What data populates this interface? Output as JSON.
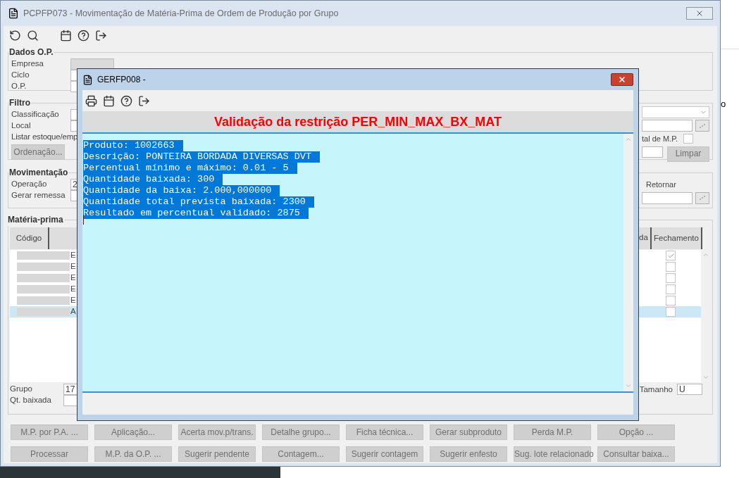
{
  "window": {
    "title": "PCPFP073 - Movimentação de Matéria-Prima de Ordem de Produção por Grupo"
  },
  "dados_op": {
    "title": "Dados O.P.",
    "fields": [
      {
        "label": "Empresa"
      },
      {
        "label": "Ciclo"
      },
      {
        "label": "O.P."
      }
    ]
  },
  "filtro": {
    "title": "Filtro",
    "labels": [
      "Classificação",
      "Local",
      "Listar estoque/emp"
    ],
    "ordenacao_button": {
      "label": "Ordenação...",
      "disabled": true
    },
    "checkbox": {
      "label": "tal de M.P.",
      "checked": false
    },
    "limpar_button": {
      "label": "Limpar",
      "disabled": true
    }
  },
  "movimentacao": {
    "title": "Movimentação",
    "fields": [
      {
        "label": "Operação",
        "value": "2"
      },
      {
        "label": "Gerar remessa"
      }
    ],
    "radio_label": "Retornar"
  },
  "materia_prima": {
    "title": "Matéria-prima",
    "columns": [
      "Código",
      "da",
      "Fechamento"
    ],
    "rows": [
      {
        "column_2": "E",
        "checked": true,
        "selected": false
      },
      {
        "column_2": "E",
        "checked": false,
        "selected": false
      },
      {
        "column_2": "E",
        "checked": false,
        "selected": false
      },
      {
        "column_2": "E",
        "checked": false,
        "selected": false
      },
      {
        "column_2": "E",
        "checked": false,
        "selected": false
      },
      {
        "column_2": "A",
        "checked": false,
        "selected": true
      }
    ],
    "grupo": {
      "label": "Grupo",
      "value": "17"
    },
    "qt_baixada": {
      "label": "Qt. baixada"
    },
    "tamanho": {
      "label": "Tamanho",
      "value": "U"
    }
  },
  "buttons": [
    [
      {
        "label": "M.P. por P.A. ...",
        "disabled": true
      },
      {
        "label": "Aplicação...",
        "disabled": true
      },
      {
        "label": "Acerta mov.p/trans.",
        "disabled": true
      },
      {
        "label": "Detalhe grupo...",
        "disabled": true
      },
      {
        "label": "Ficha técnica...",
        "disabled": true
      },
      {
        "label": "Gerar subproduto",
        "disabled": true
      },
      {
        "label": "Perda M.P.",
        "disabled": true
      },
      {
        "label": "Opção ...",
        "disabled": true
      }
    ],
    [
      {
        "label": "Processar",
        "disabled": true
      },
      {
        "label": "M.P. da O.P. ...",
        "disabled": true
      },
      {
        "label": "Sugerir pendente",
        "disabled": true
      },
      {
        "label": "Contagem...",
        "disabled": true
      },
      {
        "label": "Sugerir contagem",
        "disabled": true
      },
      {
        "label": "Sugerir enfesto",
        "disabled": true
      },
      {
        "label": "Sug. lote relacionado",
        "disabled": true
      },
      {
        "label": "Consultar baixa...",
        "disabled": true
      }
    ]
  ],
  "dialog": {
    "title": "GERFP008 -",
    "heading": "Validação da restrição PER_MIN_MAX_BX_MAT",
    "lines": [
      {
        "text": "Produto: 1002663",
        "selected": true
      },
      {
        "text": "Descrição: PONTEIRA BORDADA DIVERSAS DVT",
        "selected": true
      },
      {
        "text": "Percentual mínimo e máximo: 0.01 - 5",
        "selected": true
      },
      {
        "text": "Quantidade baixada: 300",
        "selected": true
      },
      {
        "text": "Quantidade da baixa: 2.000,000000",
        "selected": true
      },
      {
        "text": "Quantidade total prevista baixada: 2300",
        "selected": true
      },
      {
        "text": "Resultado em percentual validado: 2875",
        "selected": true
      }
    ]
  },
  "edge_text": "o"
}
